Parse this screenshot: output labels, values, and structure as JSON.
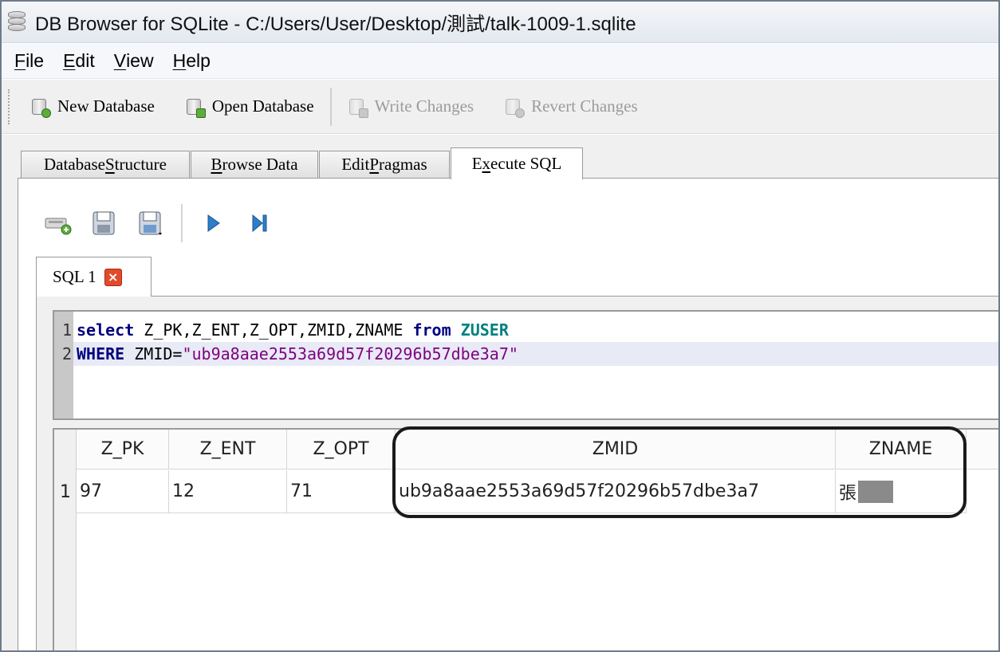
{
  "window": {
    "title": "DB Browser for SQLite - C:/Users/User/Desktop/測試/talk-1009-1.sqlite"
  },
  "menu": [
    {
      "key": "F",
      "rest": "ile"
    },
    {
      "key": "E",
      "rest": "dit"
    },
    {
      "key": "V",
      "rest": "iew"
    },
    {
      "key": "H",
      "rest": "elp"
    }
  ],
  "toolbar": {
    "new_database": "New Database",
    "open_database": "Open Database",
    "write_changes": "Write Changes",
    "revert_changes": "Revert Changes"
  },
  "tabs": {
    "structure": {
      "pre": "Database ",
      "u": "S",
      "post": "tructure"
    },
    "browse": {
      "pre": "",
      "u": "B",
      "post": "rowse Data"
    },
    "pragmas": {
      "pre": "Edit ",
      "u": "P",
      "post": "ragmas"
    },
    "execute": {
      "pre": "E",
      "u": "x",
      "post": "ecute SQL"
    }
  },
  "sql_tab": {
    "label": "SQL 1",
    "close": "×"
  },
  "editor": {
    "lines": [
      {
        "num": "1",
        "kw1": "select",
        "mid": " Z_PK,Z_ENT,Z_OPT,ZMID,ZNAME ",
        "kw2": "from",
        "sp": " ",
        "table": "ZUSER"
      },
      {
        "num": "2",
        "kw1": "WHERE",
        "mid": " ZMID=",
        "str": "\"ub9a8aae2553a69d57f20296b57dbe3a7\""
      }
    ]
  },
  "results": {
    "columns": [
      "Z_PK",
      "Z_ENT",
      "Z_OPT",
      "ZMID",
      "ZNAME"
    ],
    "rows": [
      {
        "num": "1",
        "cells": [
          "97",
          "12",
          "71",
          "ub9a8aae2553a69d57f20296b57dbe3a7",
          "張"
        ]
      }
    ]
  }
}
